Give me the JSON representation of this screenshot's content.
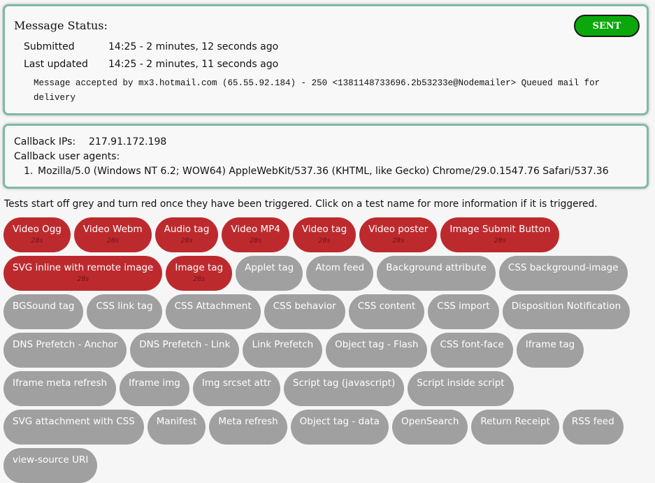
{
  "status": {
    "title": "Message Status:",
    "badge": "SENT",
    "submitted_label": "Submitted",
    "submitted_value": "14:25 - 2 minutes, 12 seconds ago",
    "updated_label": "Last updated",
    "updated_value": "14:25 - 2 minutes, 11 seconds ago",
    "smtp_response": "Message accepted by mx3.hotmail.com (65.55.92.184) - 250 <1381148733696.2b53233e@Nodemailer> Queued mail for delivery"
  },
  "callback": {
    "ips_label": "Callback IPs:",
    "ips_value": "217.91.172.198",
    "agents_label": "Callback user agents:",
    "agents": [
      {
        "num": "1.",
        "ua": "Mozilla/5.0 (Windows NT 6.2; WOW64) AppleWebKit/537.36 (KHTML, like Gecko) Chrome/29.0.1547.76 Safari/537.36"
      }
    ]
  },
  "intro": "Tests start off grey and turn red once they have been triggered. Click on a test name for more information if it is triggered.",
  "colors": {
    "triggered": "#bd2a2e",
    "untriggered": "#a0a0a0",
    "sent": "#0aa80a",
    "panel_border": "#7fb9a4"
  },
  "tests": [
    {
      "label": "Video Ogg",
      "triggered": true,
      "time": "28s"
    },
    {
      "label": "Video Webm",
      "triggered": true,
      "time": "28s"
    },
    {
      "label": "Audio tag",
      "triggered": true,
      "time": "28s"
    },
    {
      "label": "Video MP4",
      "triggered": true,
      "time": "28s"
    },
    {
      "label": "Video tag",
      "triggered": true,
      "time": "28s"
    },
    {
      "label": "Video poster",
      "triggered": true,
      "time": "28s"
    },
    {
      "label": "Image Submit Button",
      "triggered": true,
      "time": "28s"
    },
    {
      "label": "SVG inline with remote image",
      "triggered": true,
      "time": "28s"
    },
    {
      "label": "Image tag",
      "triggered": true,
      "time": "28s"
    },
    {
      "label": "Applet tag",
      "triggered": false
    },
    {
      "label": "Atom feed",
      "triggered": false
    },
    {
      "label": "Background attribute",
      "triggered": false
    },
    {
      "label": "CSS background-image",
      "triggered": false
    },
    {
      "label": "BGSound tag",
      "triggered": false
    },
    {
      "label": "CSS link tag",
      "triggered": false
    },
    {
      "label": "CSS Attachment",
      "triggered": false
    },
    {
      "label": "CSS behavior",
      "triggered": false
    },
    {
      "label": "CSS content",
      "triggered": false
    },
    {
      "label": "CSS import",
      "triggered": false
    },
    {
      "label": "Disposition Notification",
      "triggered": false
    },
    {
      "label": "DNS Prefetch - Anchor",
      "triggered": false
    },
    {
      "label": "DNS Prefetch - Link",
      "triggered": false
    },
    {
      "label": "Link Prefetch",
      "triggered": false
    },
    {
      "label": "Object tag - Flash",
      "triggered": false
    },
    {
      "label": "CSS font-face",
      "triggered": false
    },
    {
      "label": "Iframe tag",
      "triggered": false
    },
    {
      "label": "Iframe meta refresh",
      "triggered": false
    },
    {
      "label": "Iframe img",
      "triggered": false
    },
    {
      "label": "Img srcset attr",
      "triggered": false
    },
    {
      "label": "Script tag (javascript)",
      "triggered": false
    },
    {
      "label": "Script inside script",
      "triggered": false
    },
    {
      "label": "SVG attachment with CSS",
      "triggered": false
    },
    {
      "label": "Manifest",
      "triggered": false
    },
    {
      "label": "Meta refresh",
      "triggered": false
    },
    {
      "label": "Object tag - data",
      "triggered": false
    },
    {
      "label": "OpenSearch",
      "triggered": false
    },
    {
      "label": "Return Receipt",
      "triggered": false
    },
    {
      "label": "RSS feed",
      "triggered": false
    },
    {
      "label": "view-source URI",
      "triggered": false
    }
  ]
}
